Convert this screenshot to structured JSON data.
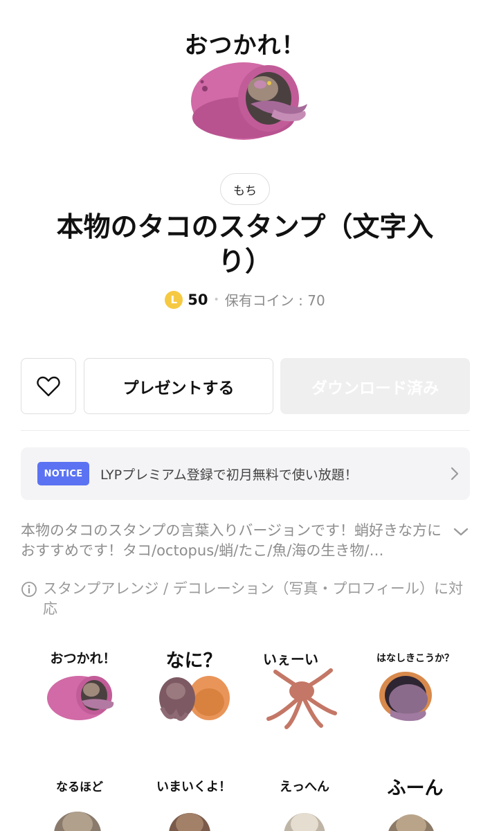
{
  "main_sticker": {
    "caption": "おつかれ！"
  },
  "author": "もち",
  "title": "本物のタコのスタンプ（文字入り）",
  "price": {
    "coin_symbol": "L",
    "amount": "50",
    "separator": "•",
    "owned_coins": "保有コイン : 70"
  },
  "actions": {
    "favorite_icon": "heart-outline-icon",
    "present_label": "プレゼントする",
    "download_label": "ダウンロード済み"
  },
  "notice": {
    "badge": "NOTICE",
    "text": "LYPプレミアム登録で初月無料で使い放題！",
    "chevron_icon": "chevron-right-icon"
  },
  "description": {
    "text": "本物のタコのスタンプの言葉入りバージョンです！蛸好きな方におすすめです！タコ/octopus/蛸/たこ/魚/海の生き物/…",
    "toggle_icon": "chevron-down-icon"
  },
  "arrange_note": {
    "icon": "info-icon",
    "text": "スタンプアレンジ / デコレーション（写真・プロフィール）に対応"
  },
  "stickers": [
    {
      "label": "おつかれ！"
    },
    {
      "label": "なに？"
    },
    {
      "label": "いぇーい"
    },
    {
      "label": "はなしきこうか？"
    },
    {
      "label": "なるほど"
    },
    {
      "label": "いまいくよ！"
    },
    {
      "label": "えっへん"
    },
    {
      "label": "ふーん"
    }
  ],
  "colors": {
    "accent": "#5b73f2",
    "coin": "#f6c942",
    "disabled_button": "#efefef"
  }
}
